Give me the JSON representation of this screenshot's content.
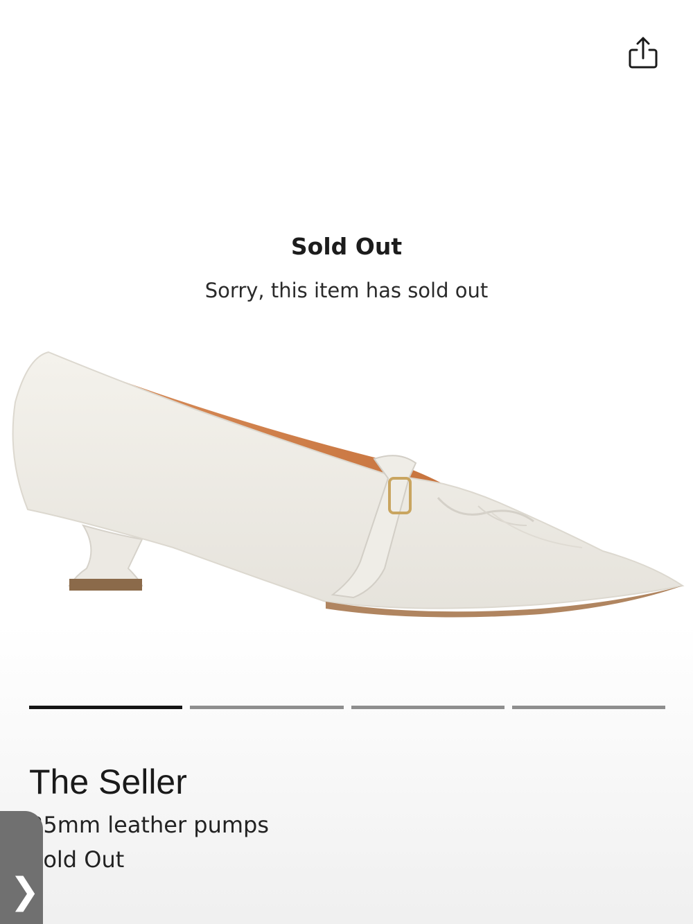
{
  "header": {
    "share_icon": "share-icon"
  },
  "status_overlay": {
    "heading": "Sold Out",
    "message": "Sorry, this item has sold out"
  },
  "gallery": {
    "image_count": 4,
    "active_index": 0
  },
  "product": {
    "brand": "The Seller",
    "name": "35mm leather pumps",
    "status": "Sold Out"
  },
  "side_tab": {
    "icon": "chevron-right-icon",
    "glyph": "❯"
  },
  "colors": {
    "active_indicator": "#141414",
    "inactive_indicator": "#8e8e8e",
    "side_tab": "#707070"
  }
}
